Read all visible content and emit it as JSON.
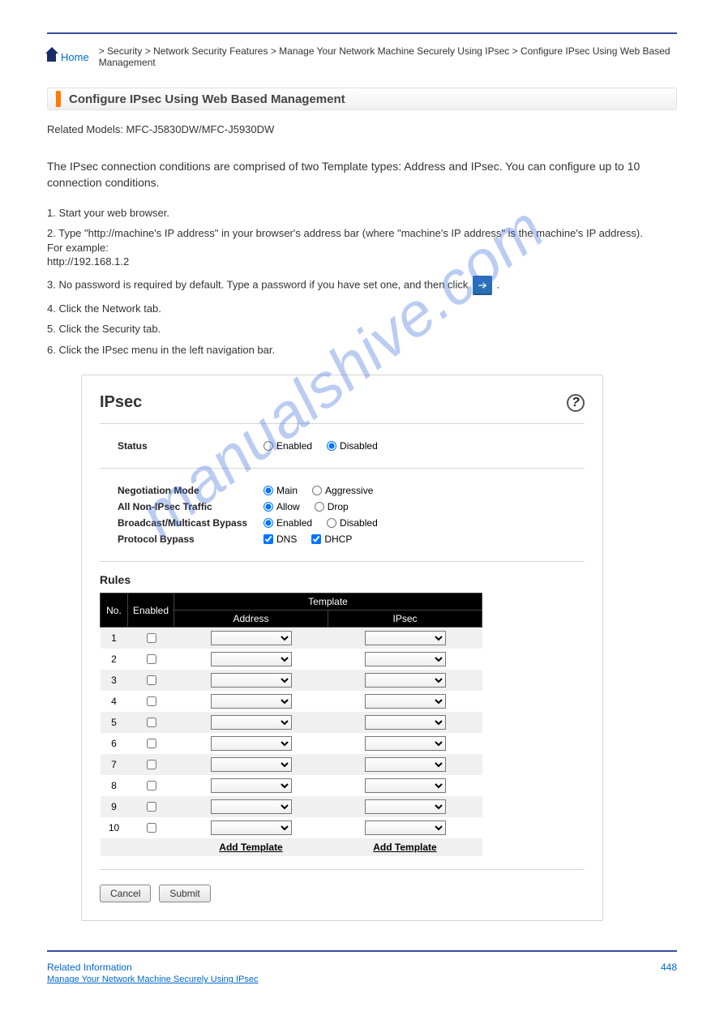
{
  "breadcrumb": {
    "home": "Home",
    "sep": " > ",
    "s1": "Security",
    "s2": "Network Security Features",
    "s3": "Manage Your Network Machine Securely Using IPsec",
    "s4": "Configure IPsec Using Web Based Management"
  },
  "titlebar": "Configure IPsec Using Web Based Management",
  "intro": "The IPsec connection conditions are comprised of two Template types: Address and IPsec. You can configure up to 10 connection conditions.",
  "models": "Related Models: MFC-J5830DW/MFC-J5930DW",
  "steps": {
    "s1a": "1. Start your web browser.",
    "s2a": "2. Type \"http://machine's IP address\" in your browser's address bar (where \"machine's IP address\" is the machine's IP address).",
    "s2b": "For example:",
    "s2c": "http://192.168.1.2",
    "s3a": "3. No password is required by default. Type a password if you have set one, and then click ",
    "s3b": ".",
    "s4a": "4. Click the Network tab.",
    "s5a": "5. Click the Security tab.",
    "s6a": "6. Click the IPsec menu in the left navigation bar."
  },
  "panel": {
    "title": "IPsec",
    "status_lbl": "Status",
    "status_enabled": "Enabled",
    "status_disabled": "Disabled",
    "neg_lbl": "Negotiation Mode",
    "neg_main": "Main",
    "neg_aggr": "Aggressive",
    "traf_lbl": "All Non-IPsec Traffic",
    "traf_allow": "Allow",
    "traf_drop": "Drop",
    "bcast_lbl": "Broadcast/Multicast Bypass",
    "bcast_en": "Enabled",
    "bcast_dis": "Disabled",
    "prot_lbl": "Protocol Bypass",
    "prot_dns": "DNS",
    "prot_dhcp": "DHCP",
    "rules_hd": "Rules",
    "th_no": "No.",
    "th_en": "Enabled",
    "th_temp": "Template",
    "th_addr": "Address",
    "th_ipsec": "IPsec",
    "rows": [
      1,
      2,
      3,
      4,
      5,
      6,
      7,
      8,
      9,
      10
    ],
    "add_template": "Add Template",
    "cancel": "Cancel",
    "submit": "Submit"
  },
  "footer": {
    "related": "Related Information",
    "page": "448",
    "link": "Manage Your Network Machine Securely Using IPsec"
  }
}
